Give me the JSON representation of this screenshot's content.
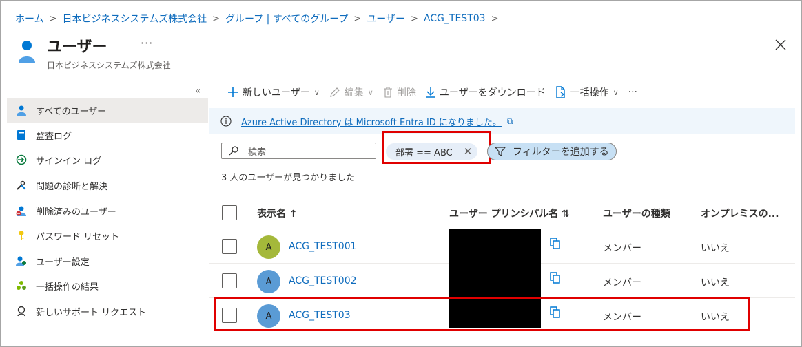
{
  "breadcrumb": [
    "ホーム",
    "日本ビジネスシステムズ株式会社",
    "グループ | すべてのグループ",
    "ユーザー",
    "ACG_TEST03"
  ],
  "header": {
    "title": "ユーザー",
    "more": "···",
    "subtitle": "日本ビジネスシステムズ株式会社",
    "close_icon": "close-icon"
  },
  "sidebar": {
    "collapse": "«",
    "items": [
      {
        "label": "すべてのユーザー",
        "icon": "user-icon",
        "active": true
      },
      {
        "label": "監査ログ",
        "icon": "book-icon"
      },
      {
        "label": "サインイン ログ",
        "icon": "sign-in-icon"
      },
      {
        "label": "問題の診断と解決",
        "icon": "wrench-icon"
      },
      {
        "label": "削除済みのユーザー",
        "icon": "deleted-user-icon"
      },
      {
        "label": "パスワード リセット",
        "icon": "key-icon"
      },
      {
        "label": "ユーザー設定",
        "icon": "user-settings-icon"
      },
      {
        "label": "一括操作の結果",
        "icon": "bulk-results-icon"
      },
      {
        "label": "新しいサポート リクエスト",
        "icon": "support-icon"
      }
    ]
  },
  "toolbar": {
    "new_user": "新しいユーザー",
    "edit": "編集",
    "delete": "削除",
    "download": "ユーザーをダウンロード",
    "bulk": "一括操作",
    "more": "···"
  },
  "banner": {
    "text": "Azure Active Directory は Microsoft Entra ID になりました。"
  },
  "search": {
    "placeholder": "検索"
  },
  "filters": {
    "active": "部署 == ABC",
    "add": "フィルターを追加する"
  },
  "result_count": "3 人のユーザーが見つかりました",
  "table": {
    "headers": {
      "display_name": "表示名 ↑",
      "upn": "ユーザー プリンシパル名 ⇅",
      "user_type": "ユーザーの種類",
      "on_prem": "オンプレミスの..."
    },
    "rows": [
      {
        "initial": "A",
        "name": "ACG_TEST001",
        "type": "メンバー",
        "on_prem": "いいえ",
        "avatar_color": "#a4b83a"
      },
      {
        "initial": "A",
        "name": "ACG_TEST002",
        "type": "メンバー",
        "on_prem": "いいえ",
        "avatar_color": "#5a9bd5"
      },
      {
        "initial": "A",
        "name": "ACG_TEST03",
        "type": "メンバー",
        "on_prem": "いいえ",
        "avatar_color": "#5a9bd5"
      }
    ]
  },
  "colors": {
    "accent": "#0f6cbd",
    "highlight": "#e00000",
    "banner": "#eff6fc"
  }
}
